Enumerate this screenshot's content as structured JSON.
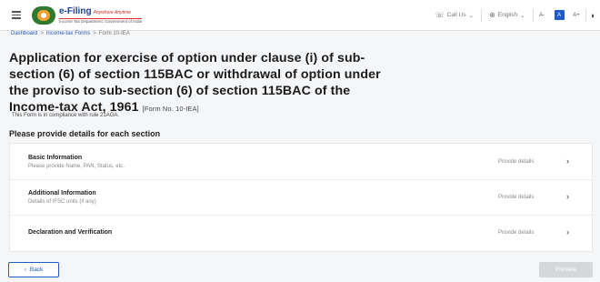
{
  "header": {
    "brand_title": "e-Filing",
    "brand_tagline": "Anywhere Anytime",
    "brand_subtitle": "Income Tax Department, Government of India",
    "call_us": "Call Us",
    "language": "English",
    "font_decrease": "A-",
    "font_normal": "A",
    "font_increase": "A+",
    "call_icon": "phone-icon",
    "language_icon": "globe-icon",
    "contrast_icon": "contrast-icon"
  },
  "breadcrumb": {
    "items": [
      "Dashboard",
      "Income-tax Forms",
      "Form 10-IEA"
    ]
  },
  "page": {
    "title": "Application for exercise of option under clause (i) of sub-section (6) of section 115BAC or withdrawal of option under the proviso to sub-section (6) of section 115BAC of the Income-tax Act, 1961",
    "form_no": "[Form No. 10-IEA]",
    "compliance": "This Form is in compliance with rule 21AGA.",
    "section_heading": "Please provide details for each section"
  },
  "sections": [
    {
      "title": "Basic Information",
      "subtitle": "Please provide Name, PAN, Status, etc.",
      "action": "Provide details"
    },
    {
      "title": "Additional Information",
      "subtitle": "Details of IFSC units (if any)",
      "action": "Provide details"
    },
    {
      "title": "Declaration and Verification",
      "subtitle": "",
      "action": "Provide details"
    }
  ],
  "footer": {
    "back_label": "Back",
    "preview_label": "Preview"
  },
  "colors": {
    "accent": "#1e5bc6",
    "disabled": "#d5d7db"
  }
}
